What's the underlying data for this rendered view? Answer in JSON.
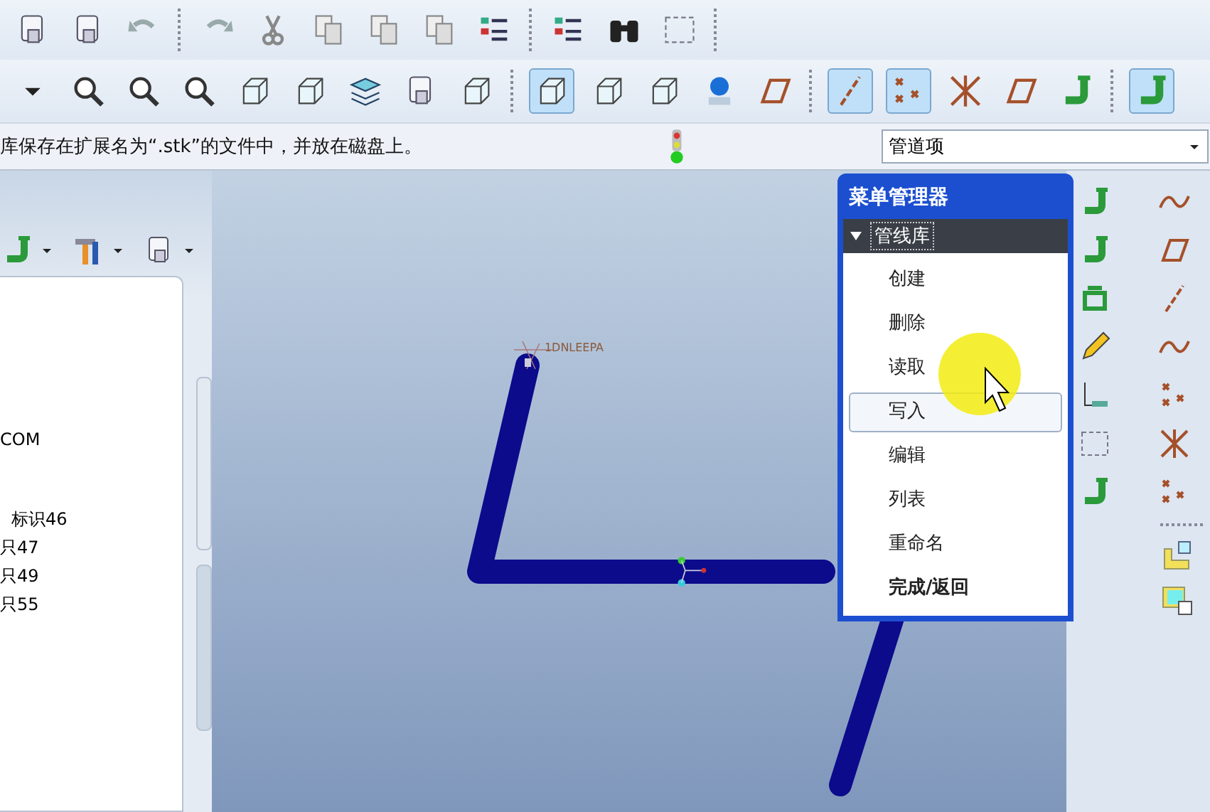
{
  "toolbars": [
    {
      "items": [
        {
          "on": false
        },
        {
          "on": false
        },
        {
          "on": false
        },
        {
          "on": false
        },
        {
          "on": false
        },
        {
          "on": false
        },
        {
          "on": false
        },
        {
          "on": false
        },
        {
          "on": false
        },
        {
          "on": false
        },
        {
          "on": false
        },
        {
          "on": false
        }
      ]
    },
    {
      "items": [
        {
          "on": false
        },
        {
          "on": false
        },
        {
          "on": false
        },
        {
          "on": false
        },
        {
          "on": false
        },
        {
          "on": false
        },
        {
          "on": false
        },
        {
          "on": false
        },
        {
          "on": false
        },
        {
          "on": true
        },
        {
          "on": false
        },
        {
          "on": false
        },
        {
          "on": false
        },
        {
          "on": false
        },
        {
          "on": true
        },
        {
          "on": true
        },
        {
          "on": false
        },
        {
          "on": false
        },
        {
          "on": false
        },
        {
          "on": true
        }
      ]
    }
  ],
  "message_bar": {
    "text": "库保存在扩展名为“.stk”的文件中，并放在磁盘上。",
    "filter": {
      "value": "管道项"
    }
  },
  "model_tree": {
    "lines": [
      "COM",
      "标识46",
      "只47",
      "只49",
      "只55"
    ]
  },
  "viewport": {
    "pipe_label": "1DNLEEPA"
  },
  "menu_manager": {
    "title": "菜单管理器",
    "section": {
      "label": "管线库",
      "expanded": true
    },
    "items": [
      {
        "label": "创建",
        "kind": "command",
        "selected": false
      },
      {
        "label": "删除",
        "kind": "command",
        "selected": false
      },
      {
        "label": "读取",
        "kind": "command",
        "selected": false
      },
      {
        "label": "写入",
        "kind": "command",
        "selected": true
      },
      {
        "label": "编辑",
        "kind": "command",
        "selected": false
      },
      {
        "label": "列表",
        "kind": "command",
        "selected": false
      },
      {
        "label": "重命名",
        "kind": "command",
        "selected": false
      },
      {
        "label": "完成/返回",
        "kind": "done",
        "selected": false
      }
    ]
  }
}
